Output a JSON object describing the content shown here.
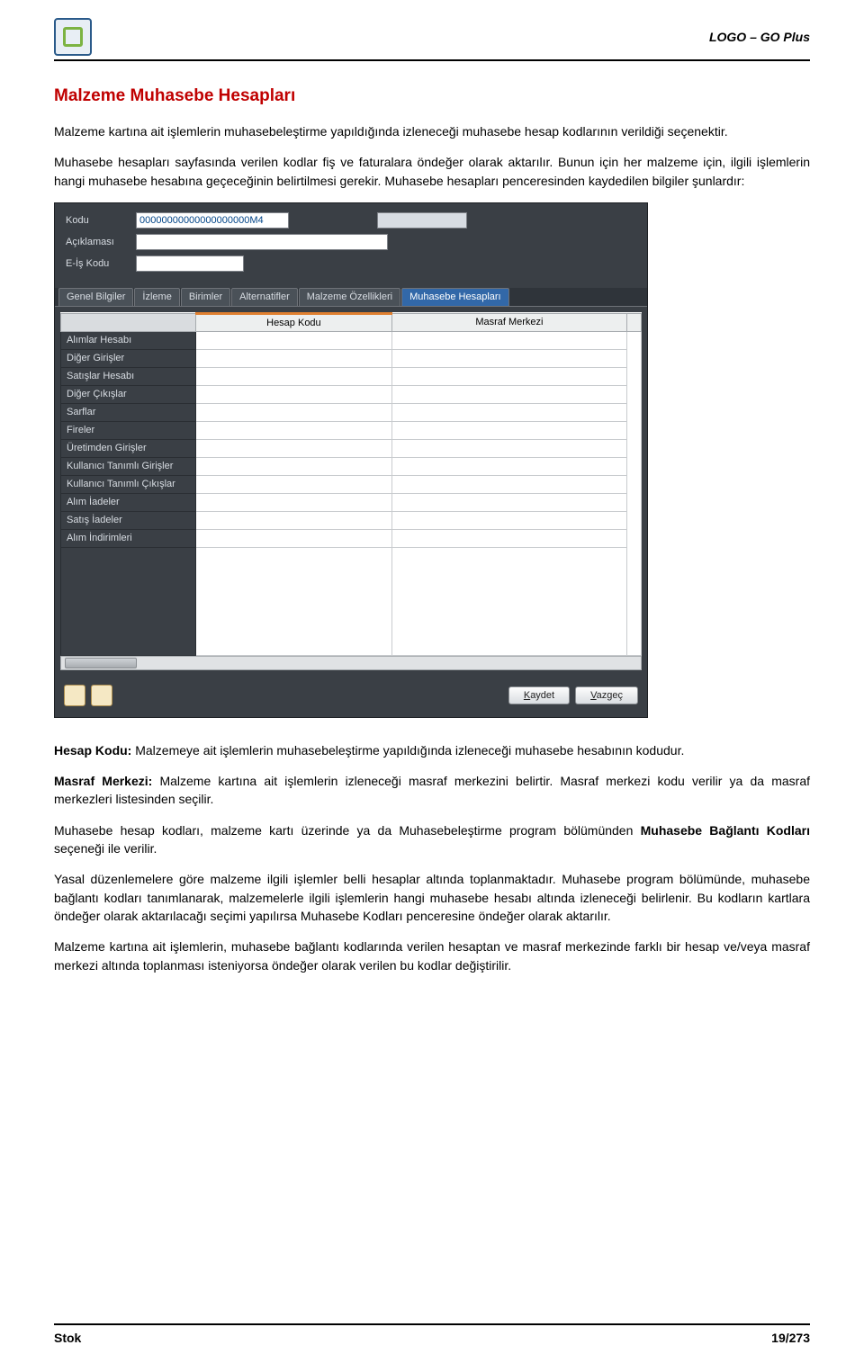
{
  "header": {
    "product": "LOGO – GO Plus"
  },
  "title": "Malzeme Muhasebe Hesapları",
  "paragraphs": {
    "p1": "Malzeme kartına ait işlemlerin muhasebeleştirme yapıldığında izleneceği muhasebe hesap kodlarının verildiği seçenektir.",
    "p2": "Muhasebe hesapları sayfasında verilen kodlar fiş ve faturalara öndeğer olarak aktarılır. Bunun için her malzeme için, ilgili işlemlerin hangi muhasebe hesabına geçeceğinin belirtilmesi gerekir. Muhasebe hesapları penceresinden kaydedilen bilgiler şunlardır:",
    "p3a": "Hesap Kodu:",
    "p3b": " Malzemeye ait işlemlerin muhasebeleştirme yapıldığında izleneceği muhasebe hesabının kodudur.",
    "p4a": "Masraf Merkezi:",
    "p4b": " Malzeme kartına ait işlemlerin izleneceği masraf merkezini belirtir. Masraf merkezi kodu verilir ya da masraf merkezleri listesinden seçilir.",
    "p5a": "Muhasebe hesap kodları, malzeme kartı üzerinde ya da Muhasebeleştirme program bölümünden ",
    "p5b": "Muhasebe Bağlantı Kodları",
    "p5c": " seçeneği ile verilir.",
    "p6": "Yasal düzenlemelere göre malzeme ilgili işlemler belli hesaplar altında toplanmaktadır. Muhasebe program bölümünde, muhasebe bağlantı kodları tanımlanarak, malzemelerle ilgili işlemlerin hangi muhasebe hesabı altında izleneceği belirlenir. Bu kodların kartlara öndeğer olarak aktarılacağı seçimi yapılırsa Muhasebe Kodları penceresine öndeğer olarak aktarılır.",
    "p7": "Malzeme kartına ait işlemlerin, muhasebe bağlantı kodlarında verilen hesaptan ve masraf merkezinde farklı bir hesap ve/veya masraf merkezi altında toplanması isteniyorsa öndeğer olarak verilen bu kodlar değiştirilir."
  },
  "window": {
    "form": {
      "code_label": "Kodu",
      "code_value": "00000000000000000000M4",
      "desc_label": "Açıklaması",
      "eis_label": "E-İş Kodu"
    },
    "tabs": [
      "Genel Bilgiler",
      "İzleme",
      "Birimler",
      "Alternatifler",
      "Malzeme Özellikleri",
      "Muhasebe Hesapları"
    ],
    "grid_headers": [
      "",
      "Hesap Kodu",
      "Masraf Merkezi"
    ],
    "grid_rows": [
      "Alımlar Hesabı",
      "Diğer Girişler",
      "Satışlar Hesabı",
      "Diğer Çıkışlar",
      "Sarflar",
      "Fireler",
      "Üretimden Girişler",
      "Kullanıcı Tanımlı Girişler",
      "Kullanıcı Tanımlı Çıkışlar",
      "Alım İadeler",
      "Satış İadeler",
      "Alım İndirimleri"
    ],
    "buttons": {
      "save_u": "K",
      "save_rest": "aydet",
      "cancel_u": "V",
      "cancel_rest": "azgeç"
    }
  },
  "footer": {
    "left": "Stok",
    "page": "19/273"
  }
}
